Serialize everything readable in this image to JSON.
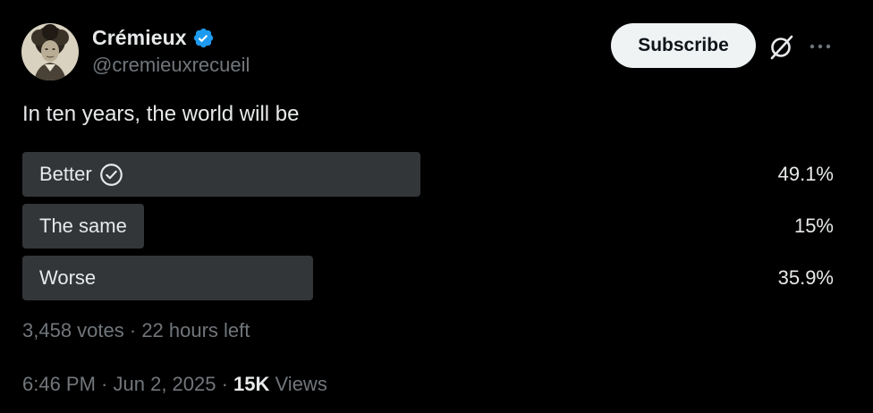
{
  "author": {
    "display_name": "Crémieux",
    "handle": "@cremieuxrecueil",
    "verified_color": "#1d9bf0",
    "avatar_icon": "sketch-portrait-avatar"
  },
  "header": {
    "subscribe_label": "Subscribe",
    "grok_icon": "grok-icon",
    "more_icon": "more-dots-icon"
  },
  "tweet": {
    "text": "In ten years, the world will be"
  },
  "poll": {
    "options": [
      {
        "label": "Better",
        "percent_text": "49.1%",
        "percent": 49.1,
        "selected": true
      },
      {
        "label": "The same",
        "percent_text": "15%",
        "percent": 15,
        "selected": false
      },
      {
        "label": "Worse",
        "percent_text": "35.9%",
        "percent": 35.9,
        "selected": false
      }
    ],
    "votes": "3,458 votes",
    "separator": " · ",
    "time_left": "22 hours left",
    "bar_color": "#333639"
  },
  "footer": {
    "time": "6:46 PM",
    "separator": " · ",
    "date": "Jun 2, 2025",
    "views_count": "15K",
    "views_label": "Views"
  },
  "colors": {
    "background": "#000000",
    "text_primary": "#e7e9ea",
    "text_secondary": "#71767b",
    "accent": "#1d9bf0"
  }
}
